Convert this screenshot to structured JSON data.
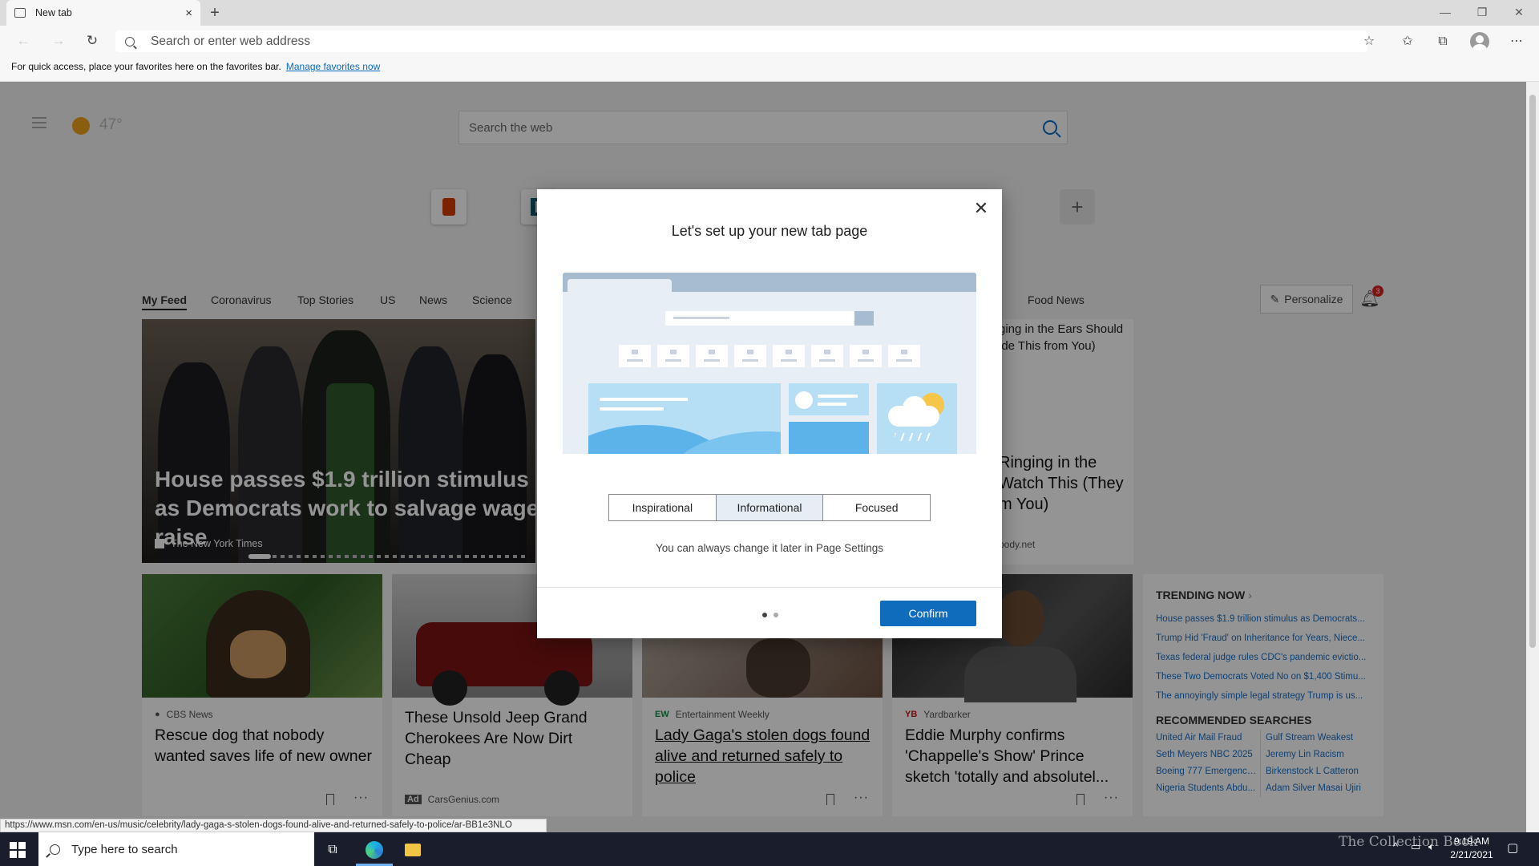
{
  "browser": {
    "tab_title": "New tab",
    "tab_close": "×",
    "new_tab": "+",
    "address_placeholder": "Search or enter web address",
    "favorites_hint": "For quick access, place your favorites here on the favorites bar.",
    "favorites_link": "Manage favorites now",
    "status_url": "https://www.msn.com/en-us/music/celebrity/lady-gaga-s-stolen-dogs-found-alive-and-returned-safely-to-police/ar-BB1e3NLO"
  },
  "newtab": {
    "search_placeholder": "Search the web",
    "weather_temp": "47°",
    "quicklink_add": "+",
    "feed_tabs": [
      "My Feed",
      "Coronavirus",
      "Top Stories",
      "US",
      "News",
      "Science",
      "Food News"
    ],
    "personalize_label": "Personalize",
    "notification_count": "3",
    "hero": {
      "headline": "House passes $1.9 trillion stimulus as Democrats work to salvage wage raise",
      "source": "The New York Times"
    },
    "right_card": {
      "top_text": "ging in the Ears Should ide This from You)",
      "big_text": "Ringing in the Watch This (They m You)",
      "source": "body.net"
    },
    "cards": [
      {
        "source": "CBS News",
        "source_mark": "●",
        "headline": "Rescue dog that nobody wanted saves life of new owner"
      },
      {
        "source": "CarsGenius.com",
        "source_mark": "Ad",
        "headline": "These Unsold Jeep Grand Cherokees Are Now Dirt Cheap"
      },
      {
        "source": "Entertainment Weekly",
        "source_mark": "EW",
        "headline": "Lady Gaga's stolen dogs found alive and returned safely to police"
      },
      {
        "source": "Yardbarker",
        "source_mark": "YB",
        "headline": "Eddie Murphy confirms 'Chappelle's Show' Prince sketch 'totally and absolutel..."
      }
    ],
    "trending": {
      "title": "TRENDING NOW",
      "items": [
        "House passes $1.9 trillion stimulus as Democrats...",
        "Trump Hid 'Fraud' on Inheritance for Years, Niece...",
        "Texas federal judge rules CDC's pandemic evictio...",
        "These Two Democrats Voted No on $1,400 Stimu...",
        "The annoyingly simple legal strategy Trump is us..."
      ],
      "recommended_title": "RECOMMENDED SEARCHES",
      "recommended": [
        [
          "United Air Mail Fraud",
          "Gulf Stream Weakest"
        ],
        [
          "Seth Meyers NBC 2025",
          "Jeremy Lin Racism"
        ],
        [
          "Boeing 777 Emergency ...",
          "Birkenstock L Catteron"
        ],
        [
          "Nigeria Students Abdu...",
          "Adam Silver Masai Ujiri"
        ]
      ]
    }
  },
  "modal": {
    "title": "Let's set up your new tab page",
    "options": [
      "Inspirational",
      "Informational",
      "Focused"
    ],
    "selected_option": "Informational",
    "hint": "You can always change it later in Page Settings",
    "confirm_label": "Confirm",
    "page_index": 1,
    "page_count": 2
  },
  "taskbar": {
    "search_placeholder": "Type here to search",
    "time": "9:19 AM",
    "date": "2/21/2021",
    "watermark": "The Collection Book"
  },
  "colors": {
    "accent": "#0f6cbd",
    "link": "#1a6fc4",
    "taskbar": "#1a1e2c"
  },
  "icons": [
    "tab-favicon-icon",
    "back-icon",
    "forward-icon",
    "refresh-icon",
    "search-icon",
    "add-favorite-icon",
    "favorites-icon",
    "collections-icon",
    "profile-icon",
    "more-icon",
    "close-icon",
    "bell-icon",
    "pencil-icon",
    "bookmark-icon",
    "windows-logo-icon",
    "task-view-icon",
    "edge-icon",
    "file-explorer-icon"
  ]
}
